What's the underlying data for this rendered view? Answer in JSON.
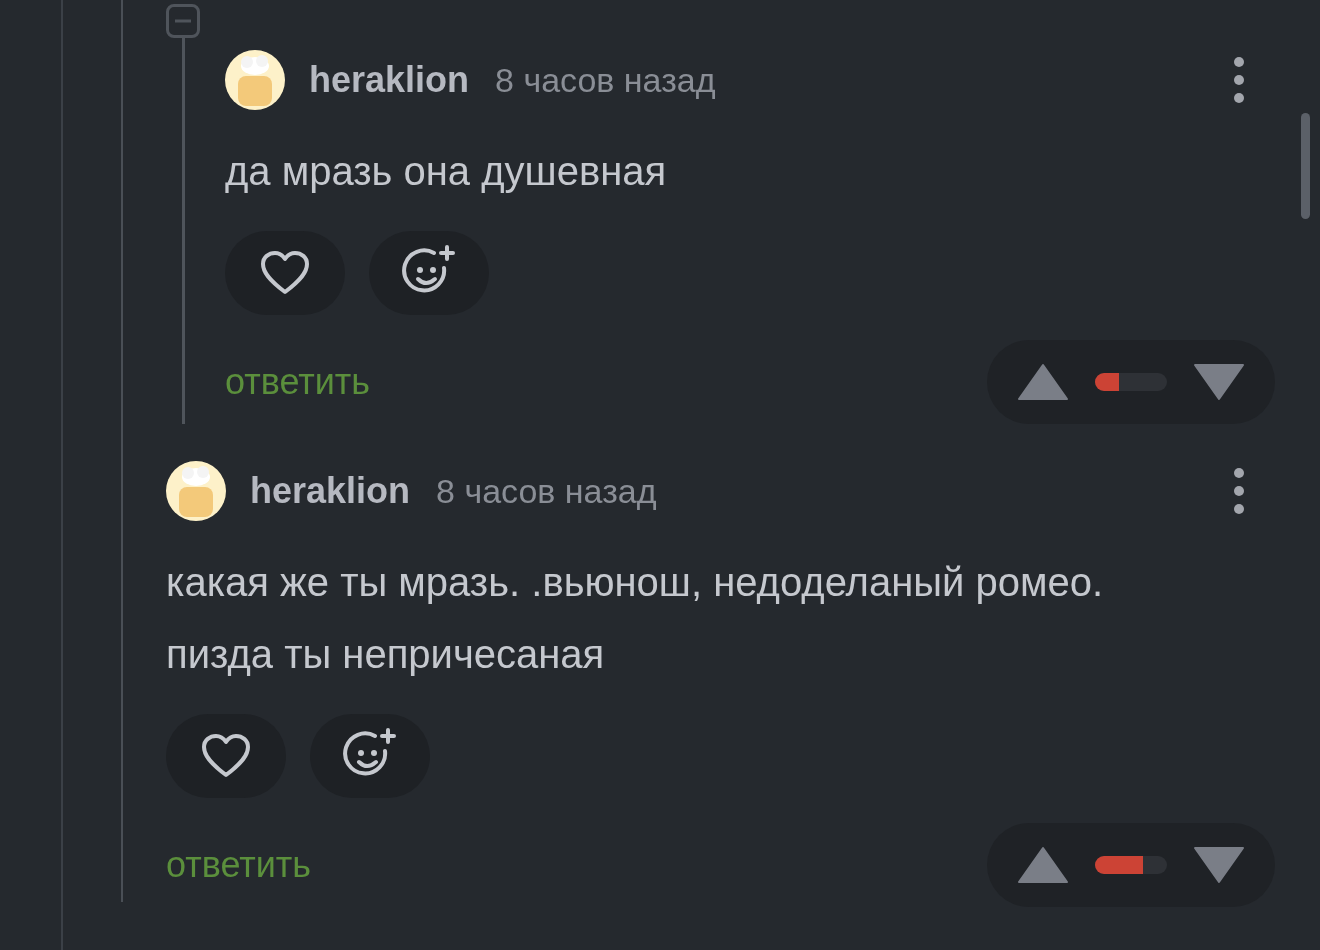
{
  "thread": {
    "collapsed": false
  },
  "comments": [
    {
      "author": "heraklion",
      "time": "8 часов назад",
      "text": "да мразь она душевная",
      "reply": "ответить",
      "liked": false,
      "level": 0.33,
      "nested": true
    },
    {
      "author": "heraklion",
      "time": "8 часов назад",
      "text": "какая же ты мразь. .вьюнош, недоделаный ромео. пизда ты непричесаная",
      "reply": "ответить",
      "liked": false,
      "level": 0.67,
      "nested": false
    }
  ]
}
